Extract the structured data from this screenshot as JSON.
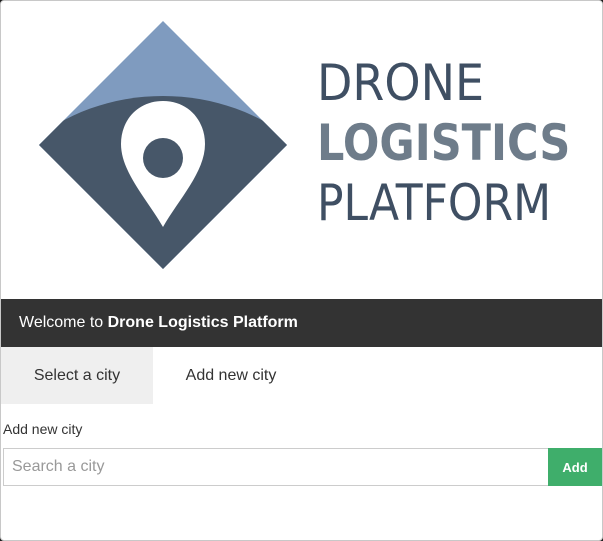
{
  "logo": {
    "line1": "DRONE",
    "line2": "LOGISTICS",
    "line3": "PLATFORM",
    "colors": {
      "diamond_light": "#7f9bbf",
      "diamond_dark": "#475769",
      "pin": "#ffffff",
      "text_dark": "#3f4f63",
      "text_light": "#6e7c8a"
    }
  },
  "welcome": {
    "prefix": "Welcome to",
    "app_name": "Drone Logistics Platform"
  },
  "tabs": [
    {
      "label": "Select a city",
      "active": true
    },
    {
      "label": "Add new city",
      "active": false
    }
  ],
  "form": {
    "label": "Add new city",
    "placeholder": "Search a city",
    "value": "",
    "add_label": "Add"
  },
  "colors": {
    "header_bg": "#333333",
    "add_button": "#3fae6b",
    "active_tab_bg": "#efefef"
  }
}
